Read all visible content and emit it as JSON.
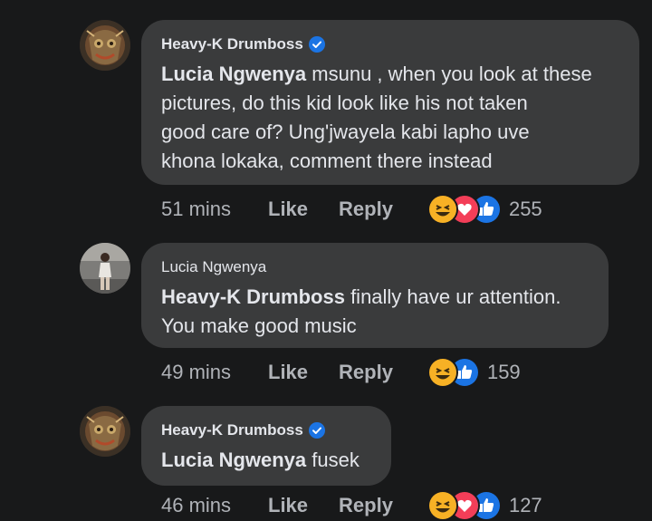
{
  "comments": [
    {
      "author": "Heavy-K Drumboss",
      "verified": true,
      "mention": "Lucia Ngwenya",
      "text_lines": [
        " msunu , when you look at these",
        "pictures, do this kid look like his not taken",
        "good care of? Ung'jwayela kabi lapho uve",
        "khona lokaka, comment there instead"
      ],
      "time": "51 mins",
      "like_label": "Like",
      "reply_label": "Reply",
      "reactions": [
        "haha-icon",
        "love-icon",
        "like-icon"
      ],
      "reaction_count": "255"
    },
    {
      "author": "Lucia Ngwenya",
      "verified": false,
      "mention": "Heavy-K Drumboss",
      "text_lines": [
        " finally have ur attention.",
        "You make good music"
      ],
      "time": "49 mins",
      "like_label": "Like",
      "reply_label": "Reply",
      "reactions": [
        "haha-icon",
        "like-icon"
      ],
      "reaction_count": "159"
    },
    {
      "author": "Heavy-K Drumboss",
      "verified": true,
      "mention": "Lucia Ngwenya",
      "text_lines": [
        " fusek"
      ],
      "time": "46 mins",
      "like_label": "Like",
      "reply_label": "Reply",
      "reactions": [
        "haha-icon",
        "love-icon",
        "like-icon"
      ],
      "reaction_count": "127"
    }
  ],
  "colors": {
    "background": "#18191a",
    "bubble": "#3a3b3c",
    "text": "#e4e6eb",
    "secondary_text": "#b0b3b8",
    "verified_blue": "#1b74e4",
    "love_red": "#f33e58",
    "haha_yellow": "#f7b125"
  }
}
